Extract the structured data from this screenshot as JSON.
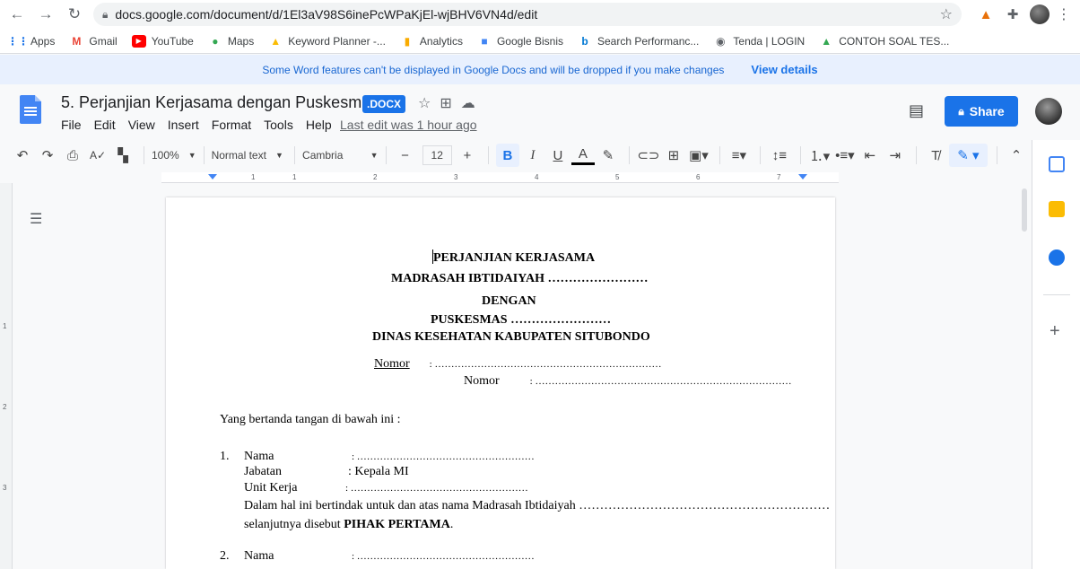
{
  "browser": {
    "url": "docs.google.com/document/d/1El3aV98S6inePcWPaKjEl-wjBHV6VN4d/edit"
  },
  "bookmarks": [
    {
      "label": "Apps",
      "icon": "apps-grid-icon",
      "color": "#1a73e8"
    },
    {
      "label": "Gmail",
      "icon": "gmail-icon",
      "color": "#ea4335"
    },
    {
      "label": "YouTube",
      "icon": "youtube-icon",
      "color": "#ff0000"
    },
    {
      "label": "Maps",
      "icon": "maps-icon",
      "color": "#34a853"
    },
    {
      "label": "Keyword Planner -...",
      "icon": "google-ads-icon",
      "color": "#fbbc04"
    },
    {
      "label": "Analytics",
      "icon": "analytics-icon",
      "color": "#f9ab00"
    },
    {
      "label": "Google Bisnis",
      "icon": "google-business-icon",
      "color": "#4285f4"
    },
    {
      "label": "Search Performanc...",
      "icon": "bing-icon",
      "color": "#0078d4"
    },
    {
      "label": "Tenda | LOGIN",
      "icon": "globe-icon",
      "color": "#5f6368"
    },
    {
      "label": "CONTOH SOAL TES...",
      "icon": "drive-icon",
      "color": "#34a853"
    }
  ],
  "banner": {
    "message": "Some Word features can't be displayed in Google Docs and will be dropped if you make changes",
    "action": "View details"
  },
  "doc": {
    "title": "5. Perjanjian Kerjasama dengan Puskesmas",
    "badge": ".DOCX",
    "menus": [
      "File",
      "Edit",
      "View",
      "Insert",
      "Format",
      "Tools",
      "Help"
    ],
    "last_edit": "Last edit was 1 hour ago",
    "share_label": "Share"
  },
  "toolbar": {
    "zoom": "100%",
    "style": "Normal text",
    "font": "Cambria",
    "font_size": "12"
  },
  "ruler": {
    "numbers": [
      "1",
      "1",
      "2",
      "3",
      "4",
      "5",
      "6",
      "7"
    ]
  },
  "vruler": {
    "numbers": [
      "1",
      "2",
      "3"
    ]
  },
  "content": {
    "title1": "PERJANJIAN KERJASAMA",
    "title2": "MADRASAH IBTIDAIYAH ……………………",
    "title3": "DENGAN",
    "title4": "PUSKESMAS ……………………",
    "title5": "DINAS KESEHATAN KABUPATEN SITUBONDO",
    "nomor1_label": "Nomor",
    "nomor1_value": ": ……………………………………………………………",
    "nomor2_label": "Nomor",
    "nomor2_value": ": ……………………………………………………………………",
    "intro": "Yang bertanda tangan di bawah ini :",
    "item1_num": "1.",
    "nama_label": "Nama",
    "nama_value": ": ………………………………………………",
    "jabatan_label": "Jabatan",
    "jabatan_value": ": Kepala MI",
    "unit_label": "Unit Kerja",
    "unit_value": ": ………………………………………………",
    "dalam": "Dalam hal ini bertindak untuk dan atas nama Madrasah Ibtidaiyah ……………………………………………………",
    "selanjutnya_pre": "selanjutnya disebut ",
    "selanjutnya_bold": "PIHAK PERTAMA",
    "selanjutnya_post": ".",
    "item2_num": "2.",
    "nama2_label": "Nama",
    "nama2_value": ": ………………………………………………"
  }
}
